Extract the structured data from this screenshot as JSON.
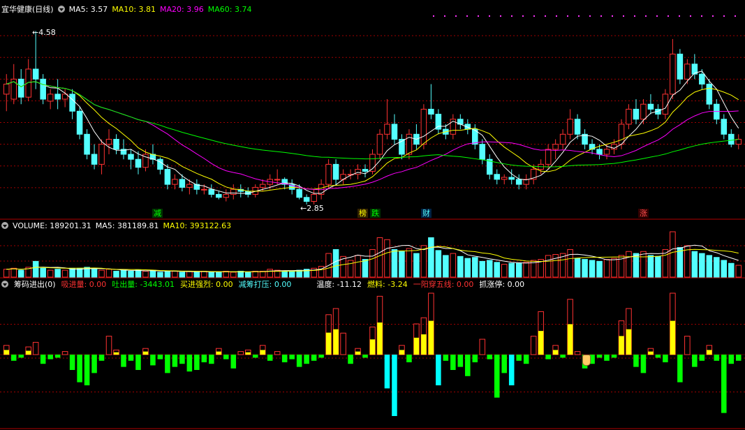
{
  "colors": {
    "up": "#ff3232",
    "down": "#54ffff",
    "ma5": "#ffffff",
    "ma10": "#ffff00",
    "ma20": "#ff00ff",
    "ma60": "#00ff00",
    "grid": "#a00000",
    "green": "#00ff00",
    "yellow": "#ffff00",
    "cyan": "#00ffff"
  },
  "main": {
    "title": "宜华健康(日线)",
    "ma5": "MA5: 3.57",
    "ma10": "MA10: 3.81",
    "ma20": "MA20: 3.96",
    "ma60": "MA60: 3.74",
    "high_label": "4.58",
    "low_label": "2.85"
  },
  "events": [
    {
      "text": "减",
      "color": "#00ff00",
      "bg": "#003300"
    },
    {
      "text": "榜",
      "color": "#ffff00",
      "bg": "#332200"
    },
    {
      "text": "跌",
      "color": "#00ff00",
      "bg": "#003300"
    },
    {
      "text": "财",
      "color": "#54ffff",
      "bg": "#002244"
    },
    {
      "text": "涨",
      "color": "#ff5050",
      "bg": "#330000"
    }
  ],
  "volume": {
    "label": "VOLUME: 189201.31",
    "ma5": "MA5: 381189.81",
    "ma10": "MA10: 393122.63"
  },
  "indicator": {
    "name": "筹码进出(0)",
    "items": [
      {
        "text": "吸进量: 0.00",
        "color": "#ff3232"
      },
      {
        "text": "吐出量: -3443.01",
        "color": "#00ff00"
      },
      {
        "text": "买进强烈: 0.00",
        "color": "#ffff00"
      },
      {
        "text": "减筹打压: 0.00",
        "color": "#54ffff"
      },
      {
        "text": "温度: -11.12",
        "color": "#ffffff"
      },
      {
        "text": "燃料: -3.24",
        "color": "#ffff00"
      },
      {
        "text": "一阳穿五线: 0.00",
        "color": "#ff3232"
      },
      {
        "text": "抓涨停: 0.00",
        "color": "#ffffff"
      }
    ]
  },
  "chart_data": {
    "type": "candlestick",
    "price_range": [
      2.8,
      4.75
    ],
    "candles": [
      [
        3.95,
        4.15,
        3.78,
        4.05
      ],
      [
        3.9,
        4.25,
        3.85,
        4.1
      ],
      [
        4.1,
        4.2,
        3.85,
        3.92
      ],
      [
        3.92,
        4.3,
        3.88,
        4.2
      ],
      [
        4.2,
        4.58,
        4.0,
        4.1
      ],
      [
        4.1,
        4.15,
        3.85,
        3.9
      ],
      [
        3.88,
        4.0,
        3.8,
        3.95
      ],
      [
        3.95,
        4.1,
        3.8,
        3.9
      ],
      [
        3.9,
        4.0,
        3.82,
        3.95
      ],
      [
        3.95,
        4.0,
        3.7,
        3.78
      ],
      [
        3.78,
        3.82,
        3.5,
        3.55
      ],
      [
        3.55,
        3.6,
        3.3,
        3.35
      ],
      [
        3.35,
        3.45,
        3.2,
        3.25
      ],
      [
        3.25,
        3.5,
        3.15,
        3.45
      ],
      [
        3.45,
        3.6,
        3.35,
        3.5
      ],
      [
        3.5,
        3.55,
        3.35,
        3.4
      ],
      [
        3.4,
        3.5,
        3.3,
        3.35
      ],
      [
        3.35,
        3.4,
        3.2,
        3.3
      ],
      [
        3.3,
        3.38,
        3.15,
        3.22
      ],
      [
        3.22,
        3.4,
        3.18,
        3.35
      ],
      [
        3.35,
        3.45,
        3.25,
        3.3
      ],
      [
        3.3,
        3.32,
        3.15,
        3.2
      ],
      [
        3.2,
        3.25,
        3.0,
        3.05
      ],
      [
        3.05,
        3.15,
        3.0,
        3.1
      ],
      [
        3.1,
        3.15,
        2.98,
        3.02
      ],
      [
        3.02,
        3.1,
        2.95,
        3.05
      ],
      [
        3.05,
        3.1,
        2.95,
        3.0
      ],
      [
        3.0,
        3.05,
        2.95,
        3.0
      ],
      [
        3.0,
        3.05,
        2.92,
        2.95
      ],
      [
        2.95,
        2.98,
        2.9,
        2.92
      ],
      [
        2.92,
        3.0,
        2.88,
        2.95
      ],
      [
        2.95,
        3.05,
        2.9,
        3.0
      ],
      [
        3.0,
        3.05,
        2.92,
        2.98
      ],
      [
        2.98,
        3.02,
        2.92,
        2.95
      ],
      [
        2.95,
        3.05,
        2.92,
        3.02
      ],
      [
        3.02,
        3.1,
        2.98,
        3.05
      ],
      [
        3.05,
        3.15,
        3.0,
        3.1
      ],
      [
        3.1,
        3.2,
        3.05,
        3.1
      ],
      [
        3.1,
        3.12,
        3.0,
        3.05
      ],
      [
        3.05,
        3.1,
        2.95,
        3.0
      ],
      [
        3.0,
        3.05,
        2.9,
        2.92
      ],
      [
        2.92,
        2.95,
        2.85,
        2.88
      ],
      [
        2.88,
        3.0,
        2.85,
        2.95
      ],
      [
        2.95,
        3.1,
        2.9,
        3.05
      ],
      [
        3.05,
        3.3,
        3.0,
        3.25
      ],
      [
        3.25,
        3.3,
        3.05,
        3.1
      ],
      [
        3.1,
        3.2,
        3.05,
        3.15
      ],
      [
        3.15,
        3.2,
        3.1,
        3.15
      ],
      [
        3.15,
        3.25,
        3.1,
        3.2
      ],
      [
        3.2,
        3.25,
        3.12,
        3.18
      ],
      [
        3.18,
        3.4,
        3.15,
        3.35
      ],
      [
        3.35,
        3.6,
        3.3,
        3.55
      ],
      [
        3.55,
        3.9,
        3.5,
        3.65
      ],
      [
        3.65,
        3.75,
        3.45,
        3.5
      ],
      [
        3.5,
        3.55,
        3.3,
        3.35
      ],
      [
        3.35,
        3.6,
        3.3,
        3.55
      ],
      [
        3.55,
        3.65,
        3.4,
        3.45
      ],
      [
        3.45,
        3.85,
        3.4,
        3.8
      ],
      [
        3.8,
        4.05,
        3.7,
        3.75
      ],
      [
        3.75,
        3.8,
        3.55,
        3.6
      ],
      [
        3.6,
        3.65,
        3.5,
        3.55
      ],
      [
        3.55,
        3.75,
        3.5,
        3.7
      ],
      [
        3.7,
        3.75,
        3.6,
        3.65
      ],
      [
        3.65,
        3.7,
        3.55,
        3.6
      ],
      [
        3.6,
        3.65,
        3.4,
        3.45
      ],
      [
        3.45,
        3.5,
        3.25,
        3.3
      ],
      [
        3.3,
        3.35,
        3.1,
        3.15
      ],
      [
        3.15,
        3.2,
        3.05,
        3.1
      ],
      [
        3.1,
        3.15,
        3.05,
        3.12
      ],
      [
        3.12,
        3.2,
        3.05,
        3.1
      ],
      [
        3.1,
        3.15,
        3.0,
        3.05
      ],
      [
        3.05,
        3.15,
        3.0,
        3.1
      ],
      [
        3.1,
        3.25,
        3.05,
        3.2
      ],
      [
        3.2,
        3.3,
        3.15,
        3.25
      ],
      [
        3.25,
        3.45,
        3.2,
        3.4
      ],
      [
        3.4,
        3.5,
        3.3,
        3.45
      ],
      [
        3.45,
        3.6,
        3.4,
        3.55
      ],
      [
        3.55,
        3.8,
        3.5,
        3.7
      ],
      [
        3.7,
        3.75,
        3.5,
        3.55
      ],
      [
        3.55,
        3.6,
        3.4,
        3.45
      ],
      [
        3.45,
        3.5,
        3.35,
        3.4
      ],
      [
        3.4,
        3.45,
        3.3,
        3.35
      ],
      [
        3.35,
        3.45,
        3.3,
        3.4
      ],
      [
        3.4,
        3.5,
        3.35,
        3.45
      ],
      [
        3.45,
        3.7,
        3.4,
        3.65
      ],
      [
        3.65,
        3.85,
        3.6,
        3.8
      ],
      [
        3.8,
        3.9,
        3.65,
        3.7
      ],
      [
        3.7,
        3.9,
        3.65,
        3.85
      ],
      [
        3.85,
        3.95,
        3.75,
        3.8
      ],
      [
        3.8,
        3.85,
        3.7,
        3.75
      ],
      [
        3.75,
        4.0,
        3.7,
        3.95
      ],
      [
        3.95,
        4.5,
        3.9,
        4.35
      ],
      [
        4.35,
        4.4,
        4.05,
        4.1
      ],
      [
        4.1,
        4.3,
        4.05,
        4.25
      ],
      [
        4.25,
        4.35,
        4.1,
        4.15
      ],
      [
        4.15,
        4.2,
        4.0,
        4.05
      ],
      [
        4.05,
        4.1,
        3.8,
        3.85
      ],
      [
        3.85,
        3.9,
        3.65,
        3.7
      ],
      [
        3.7,
        3.75,
        3.5,
        3.55
      ],
      [
        3.55,
        3.6,
        3.42,
        3.45
      ],
      [
        3.45,
        3.55,
        3.4,
        3.5
      ]
    ],
    "volume": [
      8,
      9,
      7,
      10,
      16,
      9,
      7,
      8,
      7,
      9,
      9,
      10,
      8,
      7,
      8,
      6,
      7,
      6,
      7,
      6,
      7,
      5,
      6,
      6,
      5,
      6,
      5,
      6,
      5,
      5,
      6,
      5,
      6,
      5,
      6,
      6,
      8,
      7,
      6,
      6,
      7,
      8,
      9,
      11,
      24,
      28,
      21,
      17,
      22,
      18,
      28,
      40,
      38,
      28,
      26,
      29,
      24,
      32,
      40,
      27,
      22,
      24,
      21,
      19,
      20,
      16,
      17,
      15,
      13,
      14,
      14,
      15,
      17,
      18,
      22,
      23,
      24,
      28,
      19,
      18,
      17,
      16,
      18,
      19,
      22,
      26,
      24,
      26,
      22,
      21,
      28,
      46,
      30,
      32,
      26,
      24,
      22,
      20,
      17,
      14,
      12
    ],
    "indicator": [
      6,
      -4,
      -2,
      5,
      8,
      -6,
      -3,
      -2,
      2,
      -10,
      -18,
      -20,
      -12,
      -4,
      12,
      3,
      -8,
      -4,
      -10,
      4,
      -7,
      -3,
      -12,
      -8,
      -6,
      -11,
      -10,
      -5,
      -6,
      4,
      -3,
      -9,
      2,
      3,
      -2,
      6,
      -4,
      2,
      -5,
      -3,
      -8,
      -6,
      -4,
      -2,
      26,
      30,
      14,
      -6,
      4,
      -2,
      18,
      38,
      -22,
      -40,
      6,
      -5,
      20,
      24,
      40,
      -20,
      -4,
      -10,
      -8,
      -14,
      -5,
      10,
      -3,
      -28,
      -12,
      -20,
      -4,
      -6,
      12,
      28,
      -3,
      6,
      -2,
      36,
      2,
      -9,
      -6,
      -2,
      -4,
      -2,
      22,
      30,
      -8,
      -12,
      4,
      -2,
      -5,
      40,
      -18,
      12,
      -8,
      -4,
      6,
      -4,
      -38,
      -6,
      -4
    ]
  }
}
